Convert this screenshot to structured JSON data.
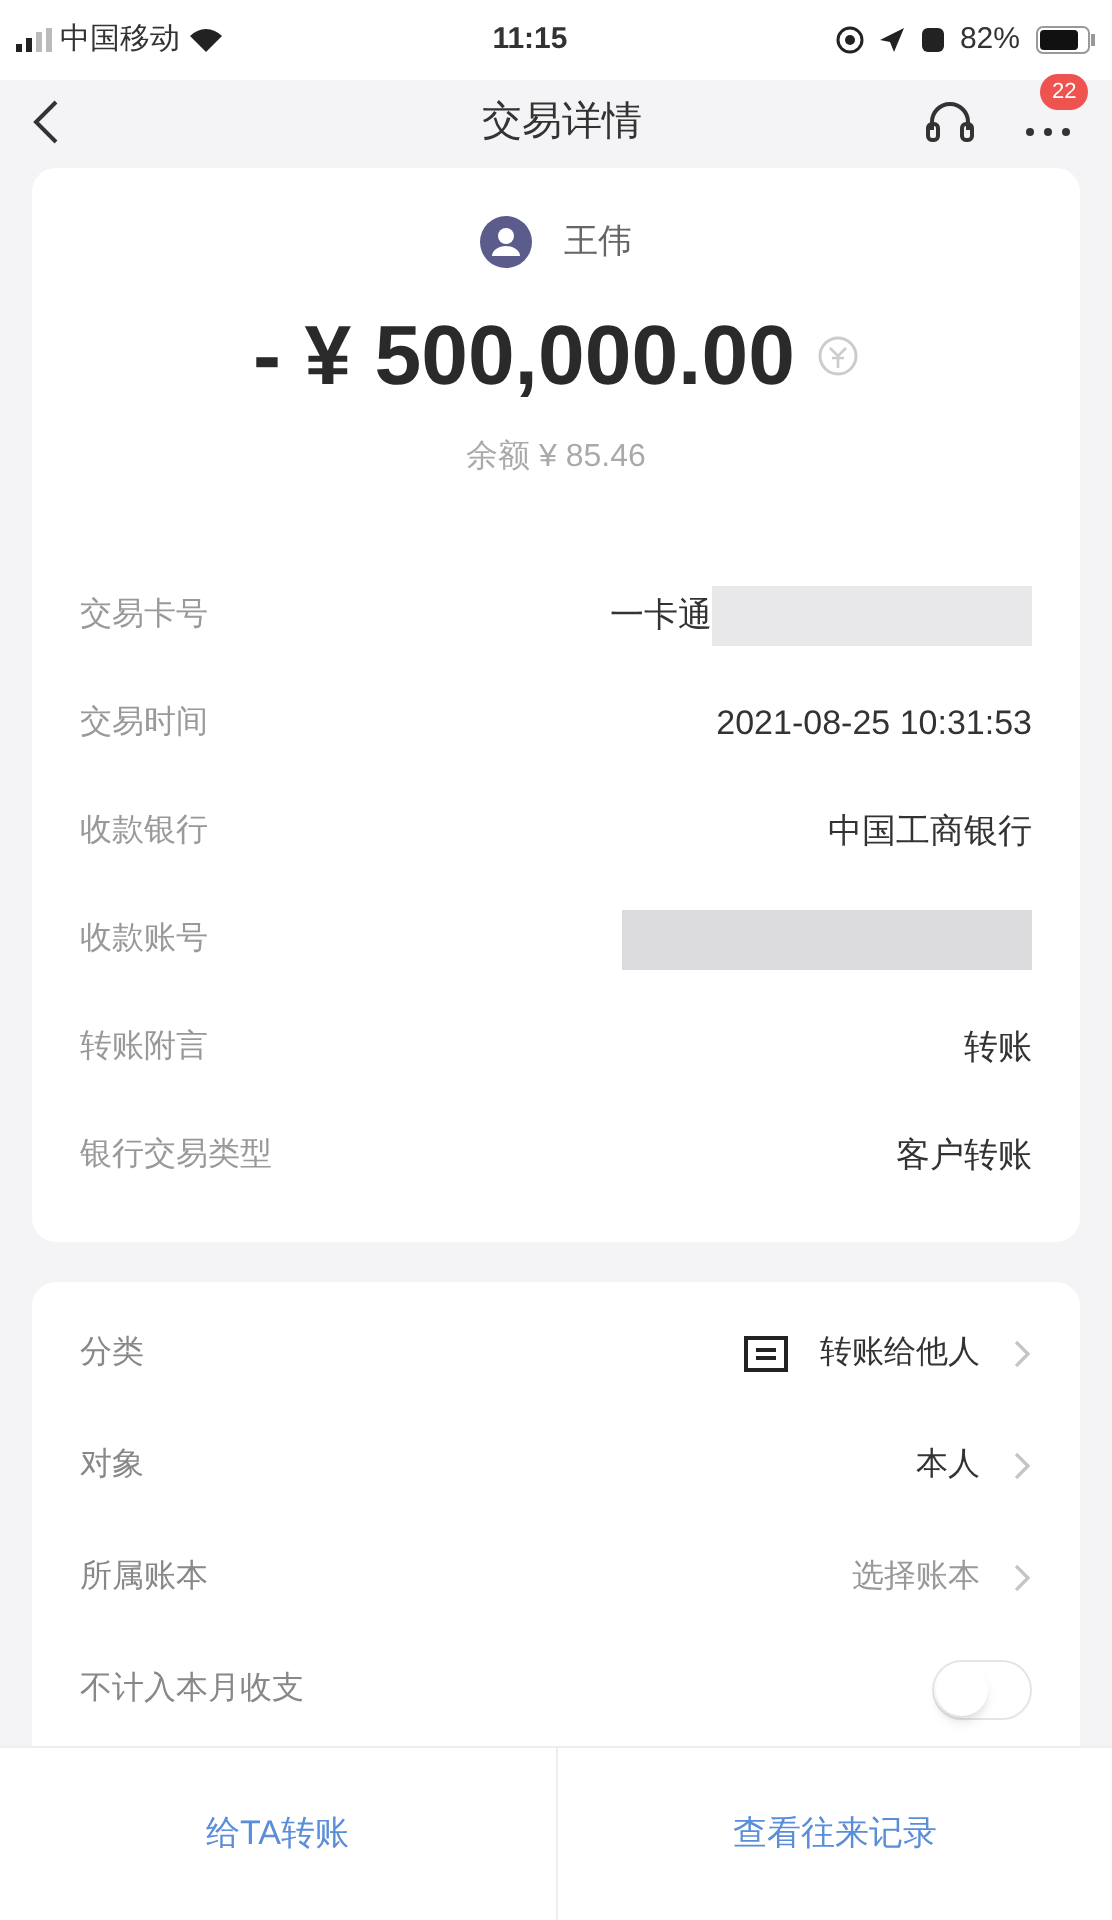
{
  "status_bar": {
    "carrier": "中国移动",
    "time": "11:15",
    "battery": "82%"
  },
  "nav": {
    "title": "交易详情",
    "badge": "22"
  },
  "summary": {
    "name": "王伟",
    "amount": "- ¥ 500,000.00",
    "balance": "余额 ¥ 85.46"
  },
  "details": [
    {
      "label": "交易卡号",
      "value": "一卡通",
      "redacted": true
    },
    {
      "label": "交易时间",
      "value": "2021-08-25 10:31:53",
      "redacted": false
    },
    {
      "label": "收款银行",
      "value": "中国工商银行",
      "redacted": false
    },
    {
      "label": "收款账号",
      "redacted": true
    },
    {
      "label": "转账附言",
      "value": "转账",
      "redacted": false
    },
    {
      "label": "银行交易类型",
      "value": "客户转账",
      "redacted": false
    }
  ],
  "settings": [
    {
      "kind": "link",
      "label": "分类",
      "value": "转账给他人",
      "icon": true,
      "muted": false
    },
    {
      "kind": "link",
      "label": "对象",
      "value": "本人",
      "icon": false,
      "muted": false
    },
    {
      "kind": "link",
      "label": "所属账本",
      "value": "选择账本",
      "icon": false,
      "muted": true
    },
    {
      "kind": "toggle",
      "label": "不计入本月收支",
      "on": false
    }
  ],
  "actions": [
    "给TA转账",
    "查看往来记录"
  ]
}
